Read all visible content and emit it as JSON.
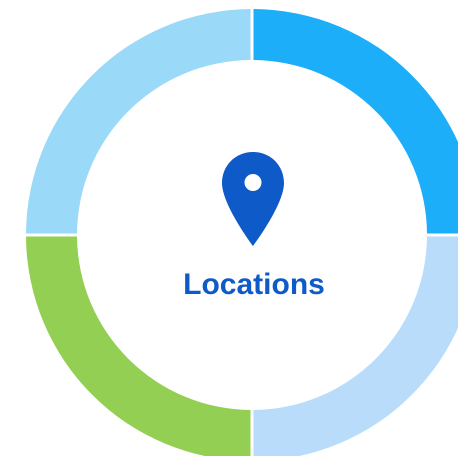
{
  "center": {
    "label": "Locations",
    "icon": "map-pin-icon",
    "label_color": "#0e5ac9",
    "icon_color": "#0e5ac9"
  },
  "ring": {
    "segments": [
      {
        "position": "top-right",
        "color": "#1caef8"
      },
      {
        "position": "bottom-right",
        "color": "#b9dcfb"
      },
      {
        "position": "bottom-left",
        "color": "#92cf52"
      },
      {
        "position": "top-left",
        "color": "#9ad9f8"
      }
    ]
  }
}
